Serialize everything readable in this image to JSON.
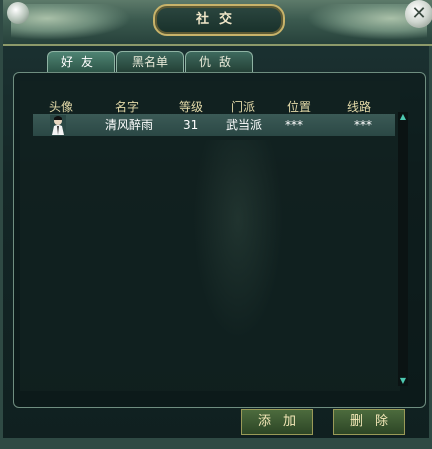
{
  "window": {
    "title": "社交",
    "close_glyph": "✕"
  },
  "tabs": [
    {
      "label": "好友",
      "active": true
    },
    {
      "label": "黑名单",
      "active": false
    },
    {
      "label": "仇敌",
      "active": false
    }
  ],
  "table": {
    "headers": [
      "头像",
      "名字",
      "等级",
      "门派",
      "位置",
      "线路"
    ],
    "rows": [
      {
        "avatar_icon": "character-portrait-icon",
        "name": "清风醉雨",
        "level": "31",
        "faction": "武当派",
        "location": "***",
        "line": "***"
      }
    ]
  },
  "buttons": {
    "add": "添加",
    "delete": "删除"
  },
  "colors": {
    "panel_bg": "#142626",
    "header_text": "#e2d9a8",
    "row_highlight": "#3b5a56",
    "scroll_arrow": "#4dc8b0"
  }
}
